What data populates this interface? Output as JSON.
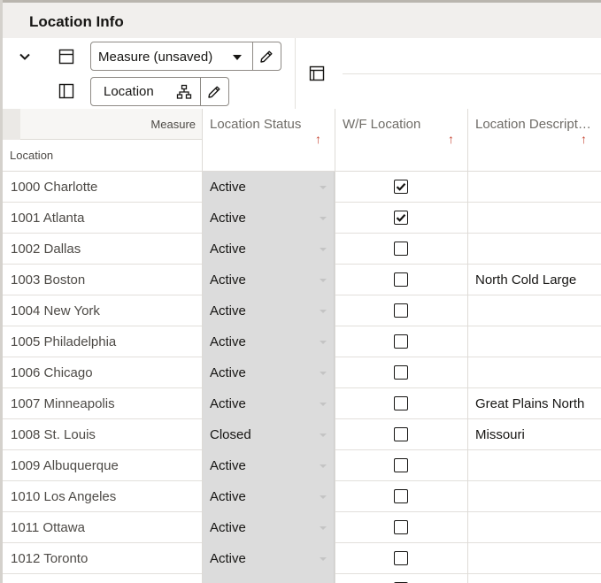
{
  "page": {
    "title": "Location Info"
  },
  "toolbar": {
    "measure_dropdown": {
      "value": "Measure (unsaved)"
    },
    "location_label": "Location"
  },
  "grid": {
    "corner": {
      "measure_label": "Measure",
      "location_label": "Location"
    },
    "columns": [
      {
        "label": "Location Status",
        "sort": "ascending"
      },
      {
        "label": "W/F Location",
        "sort": "ascending"
      },
      {
        "label": "Location Descript…",
        "sort": "ascending"
      }
    ],
    "rows": [
      {
        "location": "1000 Charlotte",
        "status": "Active",
        "wf": true,
        "description": ""
      },
      {
        "location": "1001 Atlanta",
        "status": "Active",
        "wf": true,
        "description": ""
      },
      {
        "location": "1002 Dallas",
        "status": "Active",
        "wf": false,
        "description": ""
      },
      {
        "location": "1003 Boston",
        "status": "Active",
        "wf": false,
        "description": "North Cold Large"
      },
      {
        "location": "1004 New York",
        "status": "Active",
        "wf": false,
        "description": ""
      },
      {
        "location": "1005 Philadelphia",
        "status": "Active",
        "wf": false,
        "description": ""
      },
      {
        "location": "1006 Chicago",
        "status": "Active",
        "wf": false,
        "description": ""
      },
      {
        "location": "1007 Minneapolis",
        "status": "Active",
        "wf": false,
        "description": "Great Plains North"
      },
      {
        "location": "1008 St. Louis",
        "status": "Closed",
        "wf": false,
        "description": "Missouri"
      },
      {
        "location": "1009 Albuquerque",
        "status": "Active",
        "wf": false,
        "description": ""
      },
      {
        "location": "1010 Los Angeles",
        "status": "Active",
        "wf": false,
        "description": ""
      },
      {
        "location": "1011 Ottawa",
        "status": "Active",
        "wf": false,
        "description": ""
      },
      {
        "location": "1012 Toronto",
        "status": "Active",
        "wf": false,
        "description": ""
      },
      {
        "location": "",
        "status": "",
        "wf": false,
        "description": ""
      }
    ]
  },
  "icons": {
    "collapse": "chevron-down-icon",
    "row_layout": "row-layout-icon",
    "column_layout": "column-layout-icon",
    "edit": "pencil-icon",
    "hierarchy": "hierarchy-icon",
    "pivot": "pivot-icon"
  },
  "colors": {
    "sort_arrow": "#c74634",
    "status_cell": "#dcdcdc",
    "title_bar": "#f1efed"
  }
}
